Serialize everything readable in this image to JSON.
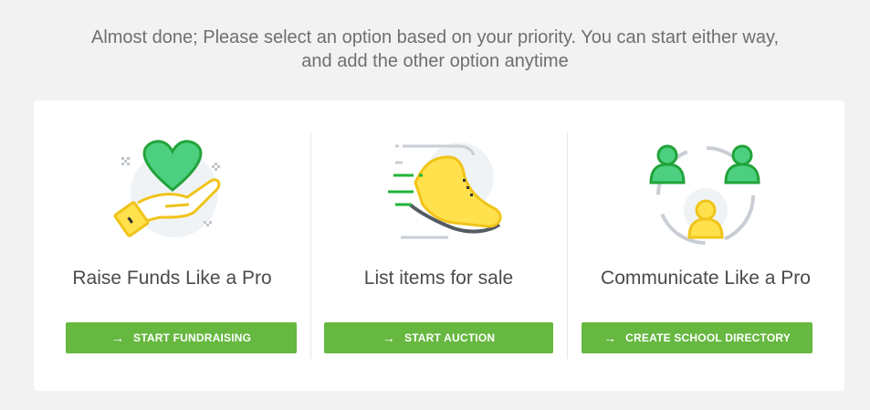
{
  "intro": {
    "line1": "Almost done; Please select an option based on your priority. You can start either way,",
    "line2": "and add the other option anytime"
  },
  "options": [
    {
      "title": "Raise Funds Like a Pro",
      "button_label": "START FUNDRAISING",
      "icon": "heart-hand-icon"
    },
    {
      "title": "List items for sale",
      "button_label": "START AUCTION",
      "icon": "running-shoe-icon"
    },
    {
      "title": "Communicate Like a Pro",
      "button_label": "CREATE SCHOOL DIRECTORY",
      "icon": "people-network-icon"
    }
  ],
  "arrow_glyph": "→",
  "colors": {
    "background": "#f2f2f2",
    "panel": "#ffffff",
    "button": "#66b840",
    "icon_green": "#4cd080",
    "icon_green_stroke": "#22a33a",
    "icon_yellow": "#ffe14d",
    "icon_yellow_stroke": "#f0c419"
  }
}
